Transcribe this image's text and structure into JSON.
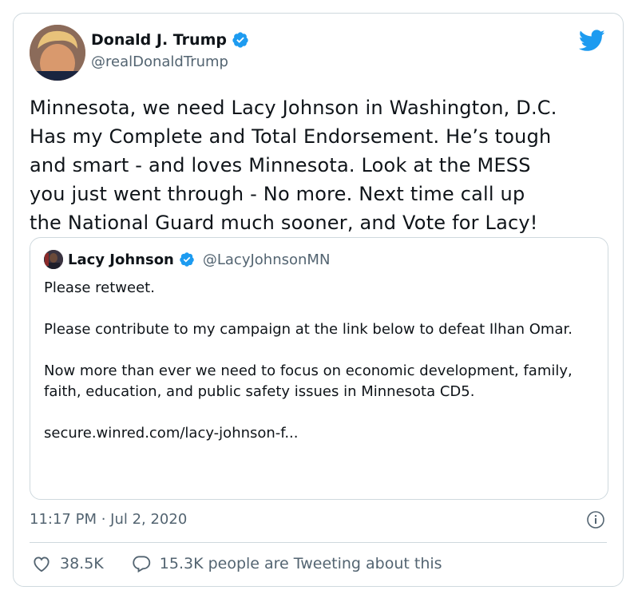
{
  "author": {
    "display_name": "Donald J. Trump",
    "handle": "@realDonaldTrump",
    "verified_icon": "verified-badge-icon",
    "avatar_icon": "profile-photo"
  },
  "brand": {
    "icon": "twitter-bird-icon",
    "color": "#1d9bf0"
  },
  "tweet": {
    "text": "Minnesota, we need Lacy Johnson in Washington, D.C.\nHas my Complete and Total Endorsement. He’s tough\nand smart - and loves Minnesota. Look at the MESS\nyou just went through - No more. Next time call up\nthe National Guard much sooner, and Vote for Lacy!"
  },
  "quoted": {
    "display_name": "Lacy Johnson",
    "handle": "@LacyJohnsonMN",
    "paragraph_1": "Please retweet.",
    "paragraph_2": "Please contribute to my campaign at the link below to defeat Ilhan Omar.",
    "paragraph_3": "Now more than ever we need to focus on economic development, family, faith, education, and public safety issues in Minnesota CD5.",
    "link": "secure.winred.com/lacy-johnson-f..."
  },
  "meta": {
    "timestamp": "11:17 PM · Jul 2, 2020",
    "info_icon": "info-icon"
  },
  "actions": {
    "likes": "38.5K",
    "conversation": "15.3K people are Tweeting about this"
  },
  "colors": {
    "text": "#0f1419",
    "secondary": "#536471",
    "border": "#cfd9de",
    "verified": "#1d9bf0"
  }
}
